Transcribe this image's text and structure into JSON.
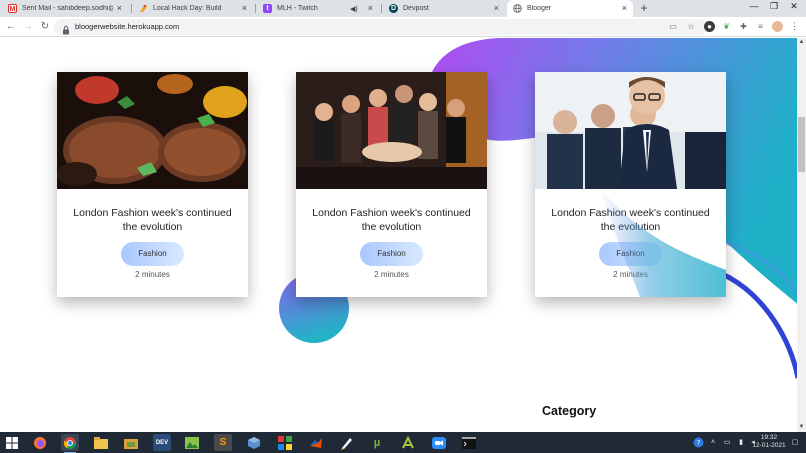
{
  "browser": {
    "tabs": [
      {
        "title": "Sent Mail - sahibdeep.sodhi@gr",
        "icon": "gmail-icon",
        "active": false
      },
      {
        "title": "Local Hack Day: Build",
        "icon": "lhd-icon",
        "active": false
      },
      {
        "title": "MLH - Twitch",
        "icon": "twitch-icon",
        "active": false,
        "muted_icon": "speaker-icon"
      },
      {
        "title": "Devpost",
        "icon": "devpost-icon",
        "active": false
      },
      {
        "title": "Blooger",
        "icon": "globe-icon",
        "active": true
      }
    ],
    "close_glyph": "×",
    "new_tab_glyph": "+",
    "window_controls": {
      "minimize": "—",
      "restore": "❐",
      "close": "✕"
    },
    "url": "bloogerwebsite.herokuapp.com",
    "nav": {
      "back": "←",
      "forward": "→",
      "reload": "↻",
      "menu": "⋮"
    }
  },
  "page": {
    "cards": [
      {
        "image": "grilled-steak-photo",
        "headline": "London Fashion week's continued the evolution",
        "tag": "Fashion",
        "read_time": "2 minutes"
      },
      {
        "image": "party-crowd-photo",
        "headline": "London Fashion week's continued the evolution",
        "tag": "Fashion",
        "read_time": "2 minutes"
      },
      {
        "image": "business-team-photo",
        "headline": "London Fashion week's continued the evolution",
        "tag": "Fashion",
        "read_time": "2 minutes"
      }
    ],
    "category_heading": "Category",
    "colors": {
      "gradient_start": "#a84cf0",
      "gradient_mid": "#6a7fe6",
      "gradient_end": "#1fb5c9",
      "pill": "#bcd6ff"
    }
  },
  "taskbar": {
    "apps": [
      {
        "name": "windows-start-icon",
        "running": false
      },
      {
        "name": "firefox-icon",
        "running": false
      },
      {
        "name": "chrome-icon",
        "running": true
      },
      {
        "name": "file-explorer-icon",
        "running": false
      },
      {
        "name": "folder-app-icon",
        "running": false
      },
      {
        "name": "dev-cpp-icon",
        "label": "DEV",
        "running": false
      },
      {
        "name": "image-viewer-icon",
        "running": false
      },
      {
        "name": "sublime-text-icon",
        "running": false
      },
      {
        "name": "virtualbox-icon",
        "running": false
      },
      {
        "name": "puzzle-app-icon",
        "running": false
      },
      {
        "name": "matlab-icon",
        "running": false
      },
      {
        "name": "pen-tool-icon",
        "running": false
      },
      {
        "name": "utorrent-icon",
        "running": false
      },
      {
        "name": "android-studio-icon",
        "running": false
      },
      {
        "name": "zoom-icon",
        "running": false
      },
      {
        "name": "terminal-icon",
        "running": false
      }
    ],
    "time": "19:32",
    "date": "12-01-2021"
  }
}
